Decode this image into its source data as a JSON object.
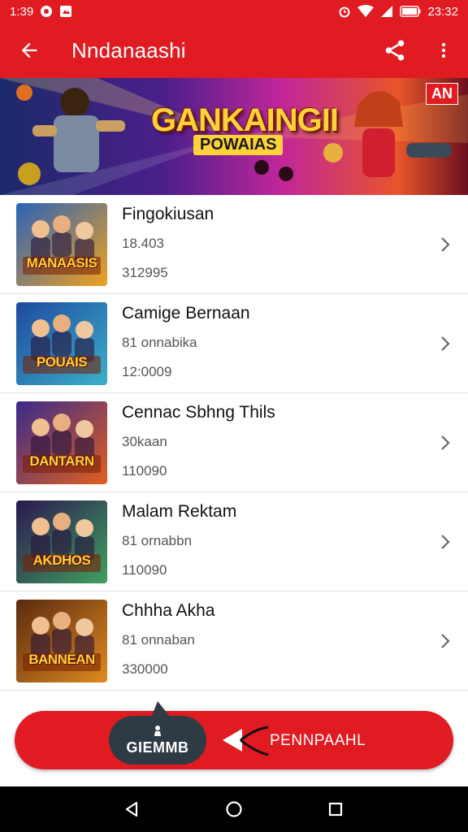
{
  "status_bar": {
    "time_left": "1:39",
    "time_right": "23:32",
    "icons": [
      "notification-icon",
      "media-icon",
      "alarm-icon",
      "wifi-icon",
      "signal-icon",
      "battery-icon"
    ]
  },
  "app_bar": {
    "title": "Nndanaashi",
    "icons": [
      "back-arrow-icon",
      "share-icon",
      "more-vert-icon"
    ]
  },
  "banner": {
    "title": "GANKAINGII",
    "subtitle": "POWAIAS",
    "badge": "AN"
  },
  "games": [
    {
      "title": "Fingokiusan",
      "subtitle": "18.403",
      "meta": "312995",
      "thumb_text": "MANAASIS",
      "thumb_color_a": "#2a63b8",
      "thumb_color_b": "#f0a020"
    },
    {
      "title": "Camige Bernaan",
      "subtitle": "81 onnabika",
      "meta": "12:0009",
      "thumb_text": "POUAIS",
      "thumb_color_a": "#1e4aa0",
      "thumb_color_b": "#3cb0c8"
    },
    {
      "title": "Cennac Sbhng Thils",
      "subtitle": "30kaan",
      "meta": "110090",
      "thumb_text": "DANTARN",
      "thumb_color_a": "#3a2a8a",
      "thumb_color_b": "#e06020"
    },
    {
      "title": "Malam Rektam",
      "subtitle": "81 ornabbn",
      "meta": "110090",
      "thumb_text": "AKDHOS",
      "thumb_color_a": "#2c1850",
      "thumb_color_b": "#40a060"
    },
    {
      "title": "Chhha Akha",
      "subtitle": "81 onnaban",
      "meta": "330000",
      "thumb_text": "BANNEAN",
      "thumb_color_a": "#5a2a10",
      "thumb_color_b": "#e08a20"
    }
  ],
  "cta": {
    "chip_label": "GIEMMB",
    "label": "PENNPAAHL"
  },
  "nav": {
    "icons": [
      "back-triangle-icon",
      "home-circle-icon",
      "recents-square-icon"
    ]
  },
  "colors": {
    "brand": "#e01b22",
    "chip": "#2e3a44"
  }
}
